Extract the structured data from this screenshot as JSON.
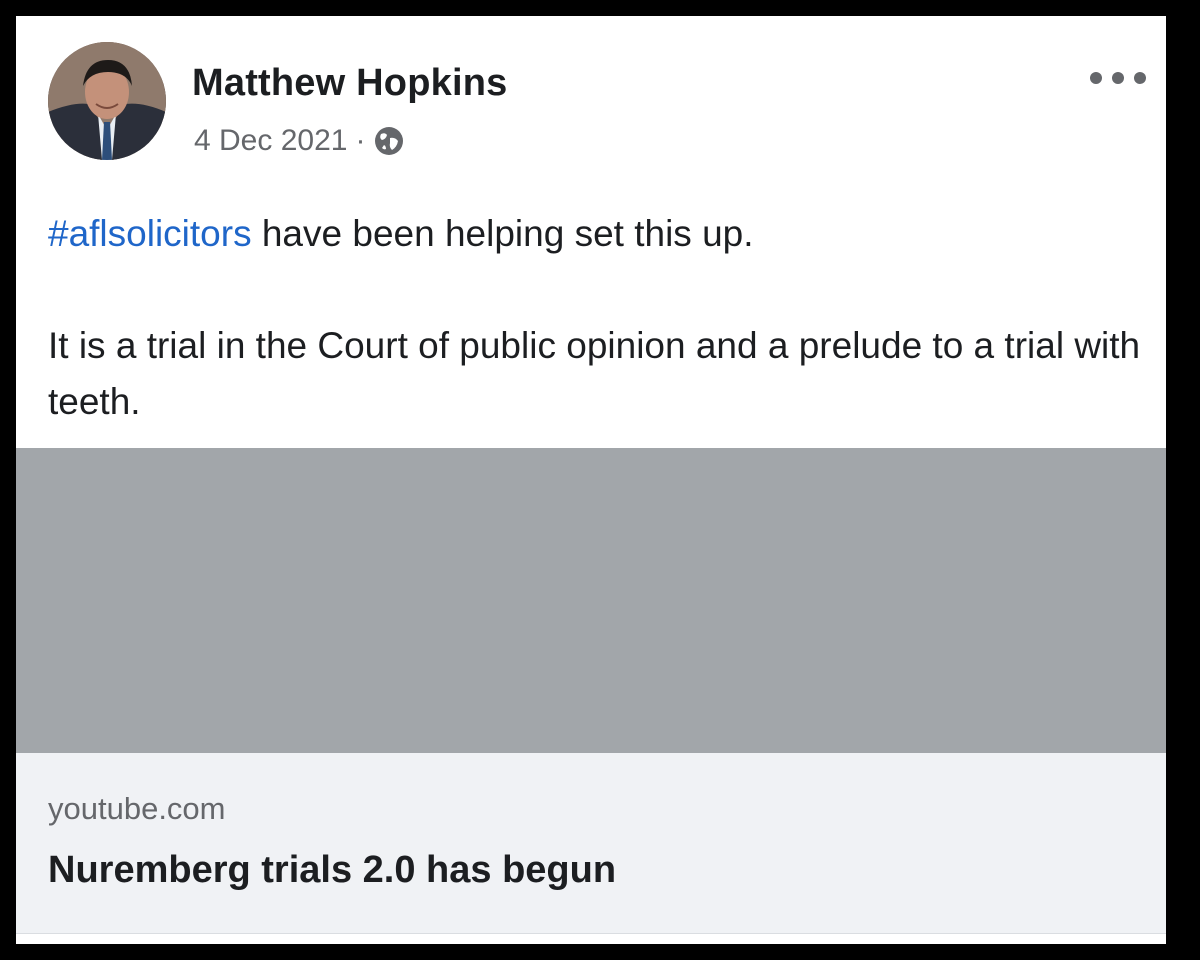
{
  "post": {
    "author": {
      "name": "Matthew Hopkins",
      "avatar_icon": "profile-photo"
    },
    "date": "4 Dec 2021",
    "separator": "·",
    "audience_icon": "globe-icon",
    "more_icon": "ellipsis-icon",
    "text": {
      "hashtag": "#aflsolicitors",
      "line1_rest": " have been helping set this up.",
      "paragraph2": "It is a trial in the Court of public opinion and a prelude to a trial with teeth."
    },
    "link_preview": {
      "domain": "youtube.com",
      "title": "Nuremberg trials 2.0 has begun"
    }
  },
  "colors": {
    "hashtag": "#1f66c9",
    "text": "#1c1e21",
    "meta": "#65676b",
    "preview_placeholder": "#a2a6aa",
    "link_card_bg": "#f0f2f5",
    "frame": "#000000"
  }
}
